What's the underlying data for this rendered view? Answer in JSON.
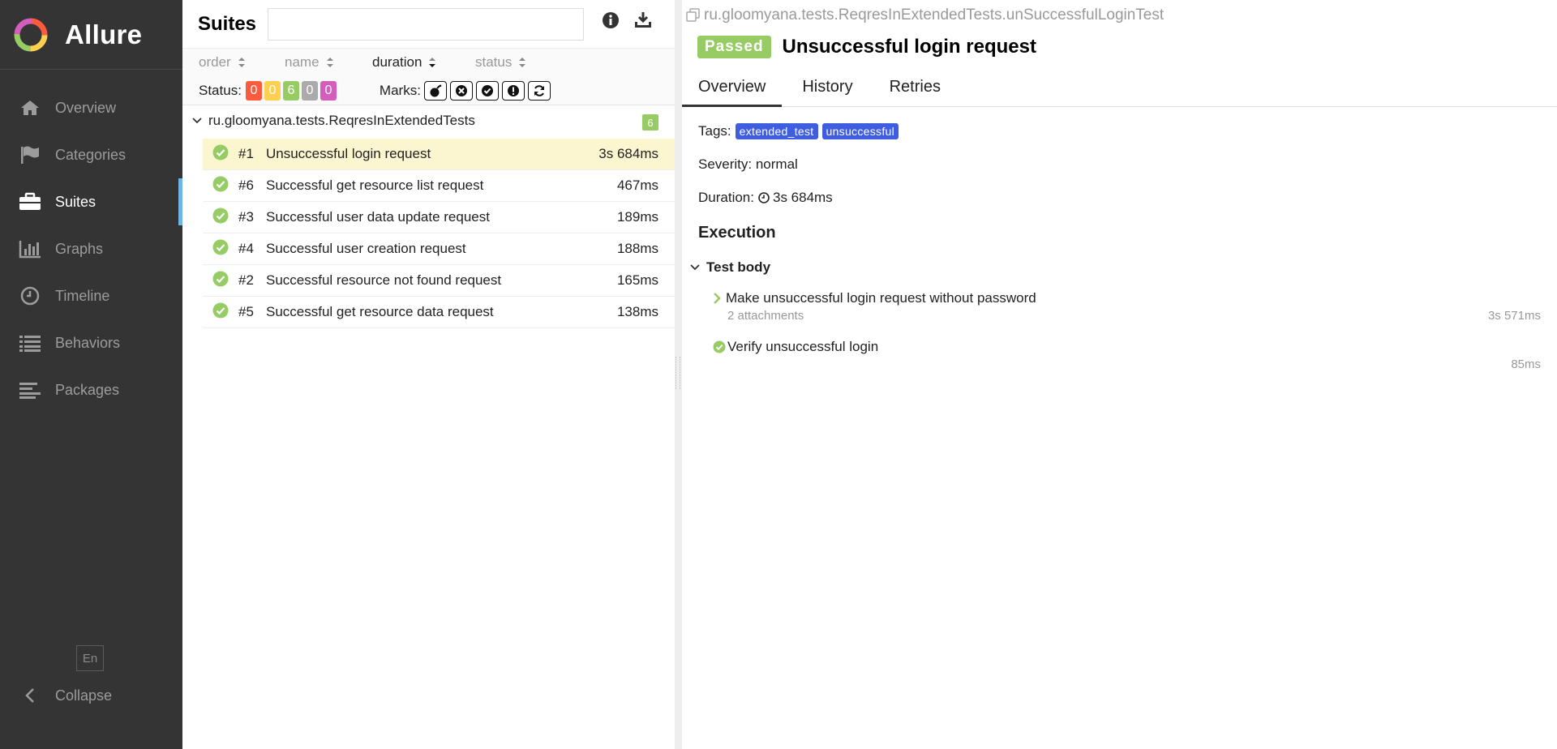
{
  "app": {
    "name": "Allure"
  },
  "colors": {
    "passed": "#97cc64",
    "failed": "#fd5a3e",
    "broken": "#ffd050",
    "skipped": "#aaaaaa",
    "unknown": "#d35ebe",
    "tag": "#3f5de0",
    "sidebar_bg": "#343434",
    "accent": "#6eb6e8"
  },
  "sidebar": {
    "items": [
      {
        "label": "Overview",
        "icon": "home-icon"
      },
      {
        "label": "Categories",
        "icon": "flag-icon"
      },
      {
        "label": "Suites",
        "icon": "briefcase-icon",
        "active": true
      },
      {
        "label": "Graphs",
        "icon": "bar-chart-icon"
      },
      {
        "label": "Timeline",
        "icon": "clock-icon"
      },
      {
        "label": "Behaviors",
        "icon": "list-icon"
      },
      {
        "label": "Packages",
        "icon": "align-left-icon"
      }
    ],
    "language": "En",
    "collapse_label": "Collapse"
  },
  "suites": {
    "title": "Suites",
    "search": {
      "value": "",
      "placeholder": ""
    },
    "sort": {
      "order": "order",
      "name": "name",
      "duration": "duration",
      "status": "status"
    },
    "filter": {
      "status_label": "Status:",
      "counts": [
        "0",
        "0",
        "6",
        "0",
        "0"
      ],
      "marks_label": "Marks:"
    },
    "group": {
      "name": "ru.gloomyana.tests.ReqresInExtendedTests",
      "count": "6"
    },
    "tests": [
      {
        "num": "#1",
        "name": "Unsuccessful login request",
        "duration": "3s 684ms",
        "selected": true
      },
      {
        "num": "#6",
        "name": "Successful get resource list request",
        "duration": "467ms"
      },
      {
        "num": "#3",
        "name": "Successful user data update request",
        "duration": "189ms"
      },
      {
        "num": "#4",
        "name": "Successful user creation request",
        "duration": "188ms"
      },
      {
        "num": "#2",
        "name": "Successful resource not found request",
        "duration": "165ms"
      },
      {
        "num": "#5",
        "name": "Successful get resource data request",
        "duration": "138ms"
      }
    ]
  },
  "detail": {
    "breadcrumb": "ru.gloomyana.tests.ReqresInExtendedTests.unSuccessfulLoginTest",
    "status": "Passed",
    "title": "Unsuccessful login request",
    "tabs": [
      "Overview",
      "History",
      "Retries"
    ],
    "tags_label": "Tags:",
    "tags": [
      "extended_test",
      "unsuccessful"
    ],
    "severity": "Severity: normal",
    "duration_label": "Duration:",
    "duration": "3s 684ms",
    "execution_title": "Execution",
    "test_body": "Test body",
    "steps": [
      {
        "name": "Make unsuccessful login request without password",
        "sub": "2 attachments",
        "duration": "3s 571ms"
      },
      {
        "name": "Verify unsuccessful login",
        "duration": "85ms"
      }
    ]
  }
}
